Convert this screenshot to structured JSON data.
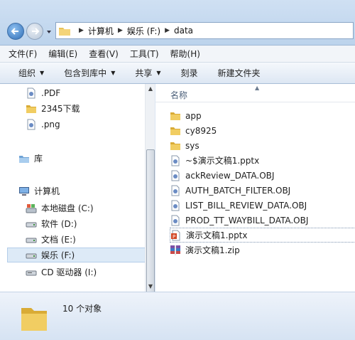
{
  "address": {
    "crumbs": [
      "计算机",
      "娱乐 (F:)",
      "data"
    ]
  },
  "menu": [
    "文件(F)",
    "编辑(E)",
    "查看(V)",
    "工具(T)",
    "帮助(H)"
  ],
  "toolbar": {
    "organize": "组织",
    "include_library": "包含到库中",
    "share": "共享",
    "burn": "刻录",
    "new_folder": "新建文件夹"
  },
  "nav": {
    "items": [
      {
        "label": ".PDF",
        "icon": "file-generic-icon"
      },
      {
        "label": "2345下载",
        "icon": "folder-icon"
      },
      {
        "label": ".png",
        "icon": "file-generic-icon"
      },
      {
        "label": "库",
        "icon": "library-icon"
      },
      {
        "label": "计算机",
        "icon": "computer-icon"
      },
      {
        "label": "本地磁盘 (C:)",
        "icon": "system-drive-icon"
      },
      {
        "label": "软件 (D:)",
        "icon": "drive-icon"
      },
      {
        "label": "文档 (E:)",
        "icon": "drive-icon"
      },
      {
        "label": "娱乐 (F:)",
        "icon": "drive-icon"
      },
      {
        "label": "CD 驱动器 (I:)",
        "icon": "cd-drive-icon"
      }
    ]
  },
  "files": {
    "column_name": "名称",
    "items": [
      {
        "label": "app",
        "icon": "folder-icon"
      },
      {
        "label": "cy8925",
        "icon": "folder-icon"
      },
      {
        "label": "sys",
        "icon": "folder-icon"
      },
      {
        "label": "~$演示文稿1.pptx",
        "icon": "file-generic-icon"
      },
      {
        "label": "ackReview_DATA.OBJ",
        "icon": "file-generic-icon"
      },
      {
        "label": "AUTH_BATCH_FILTER.OBJ",
        "icon": "file-generic-icon"
      },
      {
        "label": "LIST_BILL_REVIEW_DATA.OBJ",
        "icon": "file-generic-icon"
      },
      {
        "label": "PROD_TT_WAYBILL_DATA.OBJ",
        "icon": "file-generic-icon"
      },
      {
        "label": "演示文稿1.pptx",
        "icon": "pptx-icon"
      },
      {
        "label": "演示文稿1.zip",
        "icon": "zip-icon"
      }
    ]
  },
  "status": {
    "count": "10 个对象"
  }
}
